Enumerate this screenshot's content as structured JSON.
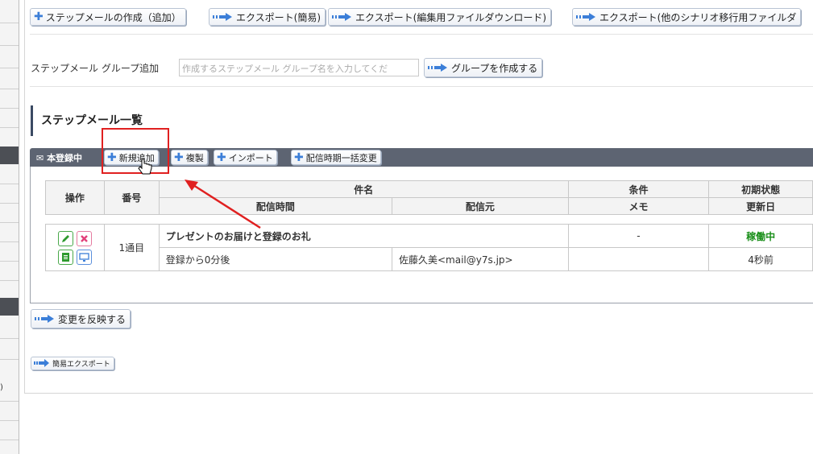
{
  "sidebar_fragment": ")",
  "toolbar": {
    "create_step_mail": "ステップメールの作成（追加）",
    "export_simple": "エクスポート(簡易)",
    "export_edit_download": "エクスポート(編集用ファイルダウンロード)",
    "export_other_scenario": "エクスポート(他のシナリオ移行用ファイルダ"
  },
  "group_add": {
    "label": "ステップメール グループ追加",
    "placeholder": "作成するステップメール グループ名を入力してくだ",
    "create_button": "グループを作成する"
  },
  "list": {
    "title": "ステップメール一覧",
    "group_name": "本登録中",
    "actions": {
      "new": "新規追加",
      "duplicate": "複製",
      "import": "インポート",
      "bulk_change": "配信時期一括変更"
    },
    "headers": {
      "operation": "操作",
      "number": "番号",
      "subject": "件名",
      "condition": "条件",
      "initial_state": "初期状態",
      "send_time": "配信時間",
      "sender": "配信元",
      "memo": "メモ",
      "updated": "更新日"
    },
    "rows": [
      {
        "number": "1通目",
        "subject": "プレゼントのお届けと登録のお礼",
        "condition": "-",
        "initial_state": "稼働中",
        "send_time": "登録から0分後",
        "sender": "佐藤久美<mail@y7s.jp>",
        "memo": "",
        "updated": "4秒前"
      }
    ]
  },
  "apply_button": "変更を反映する",
  "simple_export_button": "簡易エクスポート",
  "colors": {
    "accent_blue": "#3b7ed8",
    "header_bar": "#5d6472",
    "status_active": "#1a8f1a",
    "highlight_red": "#e02020"
  }
}
